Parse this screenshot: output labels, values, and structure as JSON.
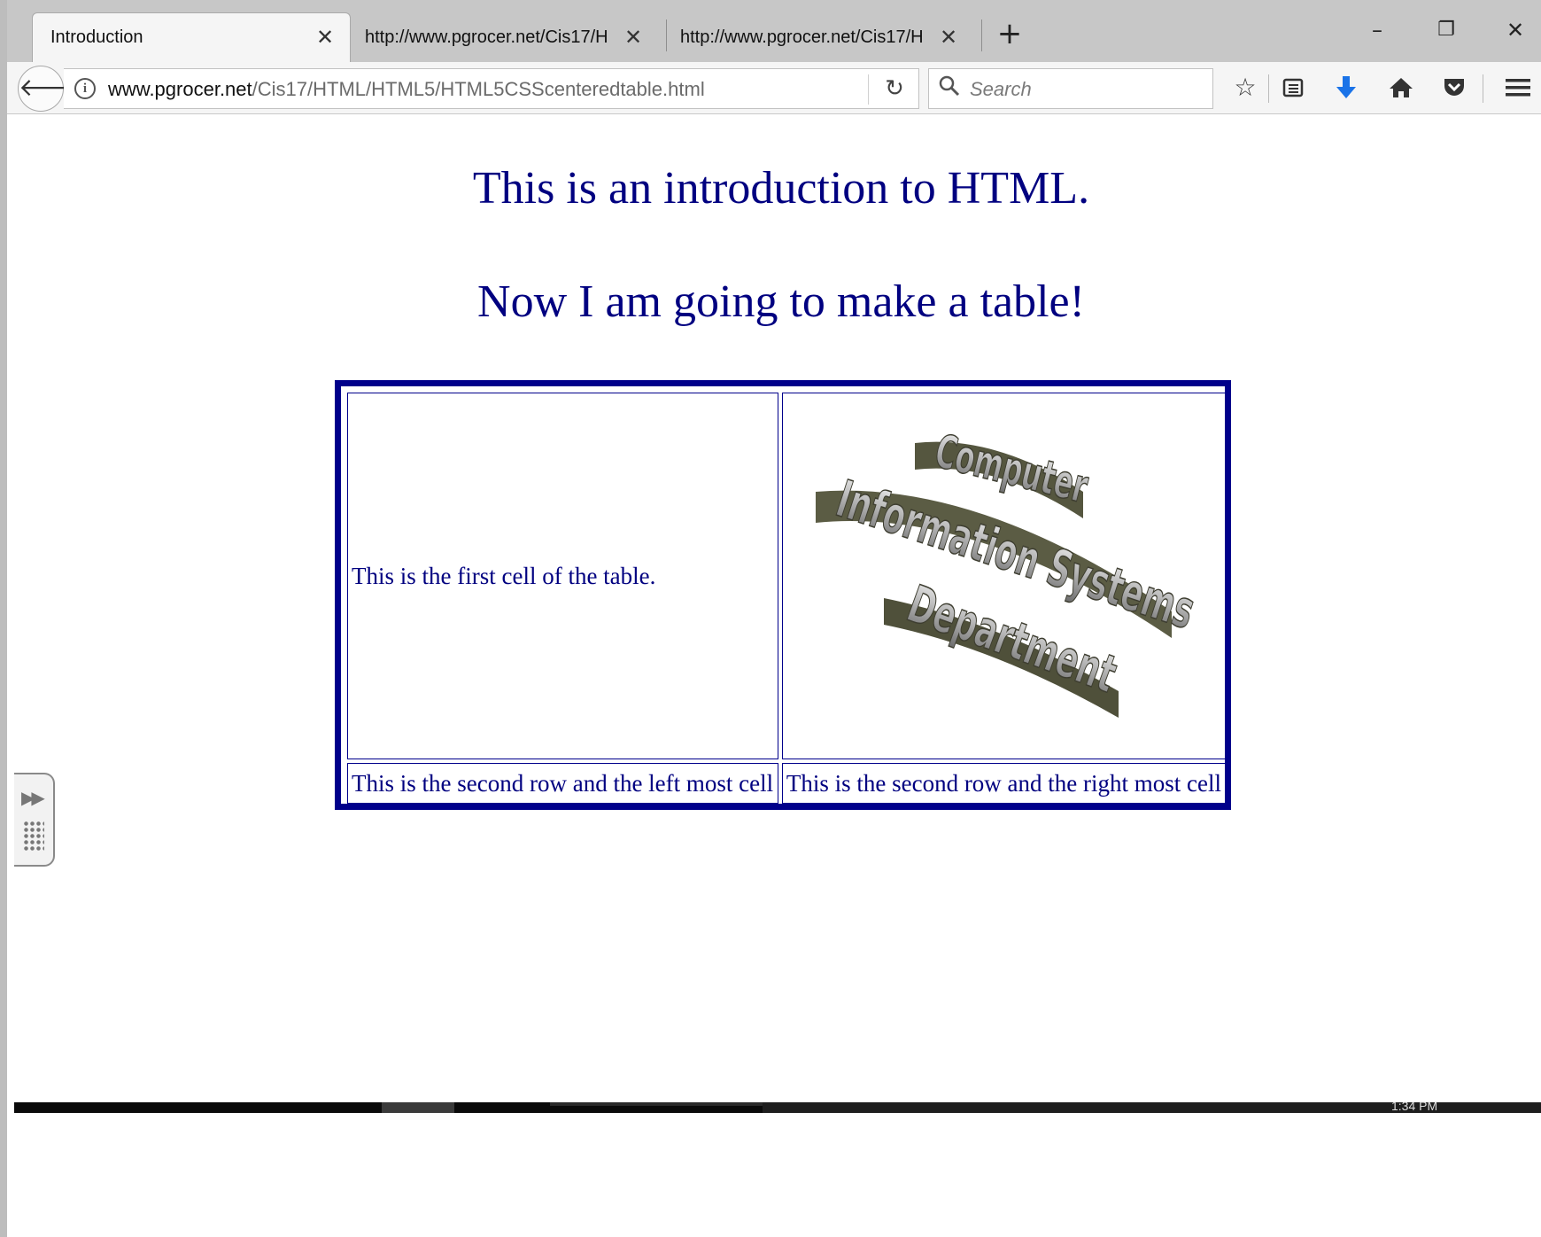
{
  "tabs": [
    {
      "label": "Introduction",
      "active": true
    },
    {
      "label": "http://www.pgrocer.net/Cis17/H",
      "active": false
    },
    {
      "label": "http://www.pgrocer.net/Cis17/H",
      "active": false
    }
  ],
  "window_controls": {
    "minimize": "–",
    "restore": "❐",
    "close": "✕"
  },
  "navbar": {
    "url_host": "www.pgrocer.net",
    "url_path": "/Cis17/HTML/HTML5/HTML5CSScenteredtable.html",
    "search_placeholder": "Search"
  },
  "icons": {
    "back": "back-arrow-icon",
    "info": "info-icon",
    "reload": "reload-icon",
    "search": "search-icon",
    "bookmark": "star-icon",
    "reading_list": "reading-list-icon",
    "downloads": "download-icon",
    "home": "home-icon",
    "pocket": "pocket-icon",
    "menu": "hamburger-menu-icon"
  },
  "page": {
    "heading1": "This is an introduction to HTML.",
    "heading2": "Now I am going to make a table!",
    "table": {
      "row1_left": "This is the first cell of the table.",
      "row1_right_image_lines": [
        "Computer",
        "Information Systems",
        "Department"
      ],
      "row2_left": "This is the second row and the left most cell",
      "row2_right": "This is the second row and the right most cell"
    }
  },
  "taskbar": {
    "clock": "1:34 PM"
  },
  "colors": {
    "text": "#000080",
    "table_border": "#00008b",
    "download_icon": "#1a73e8"
  }
}
